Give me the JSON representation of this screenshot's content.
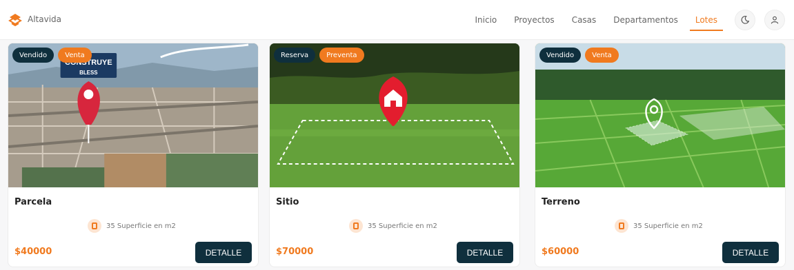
{
  "brand": {
    "name": "Altavida"
  },
  "nav": {
    "items": [
      {
        "label": "Inicio",
        "active": false
      },
      {
        "label": "Proyectos",
        "active": false
      },
      {
        "label": "Casas",
        "active": false
      },
      {
        "label": "Departamentos",
        "active": false
      },
      {
        "label": "Lotes",
        "active": true
      }
    ],
    "accent_color": "#f07a1f"
  },
  "header_icons": {
    "theme": "moon-icon",
    "user": "user-icon"
  },
  "cards": [
    {
      "badges": [
        "Vendido",
        "Venta"
      ],
      "image_text": {
        "sign_line1": "CONSTRUYE",
        "sign_line2": "BLESS"
      },
      "title": "Parcela",
      "meta": "35 Superficie en m2",
      "price": "$40000",
      "button": "DETALLE"
    },
    {
      "badges": [
        "Reserva",
        "Preventa"
      ],
      "title": "Sitio",
      "meta": "35 Superficie en m2",
      "price": "$70000",
      "button": "DETALLE"
    },
    {
      "badges": [
        "Vendido",
        "Venta"
      ],
      "title": "Terreno",
      "meta": "35 Superficie en m2",
      "price": "$60000",
      "button": "DETALLE"
    }
  ]
}
